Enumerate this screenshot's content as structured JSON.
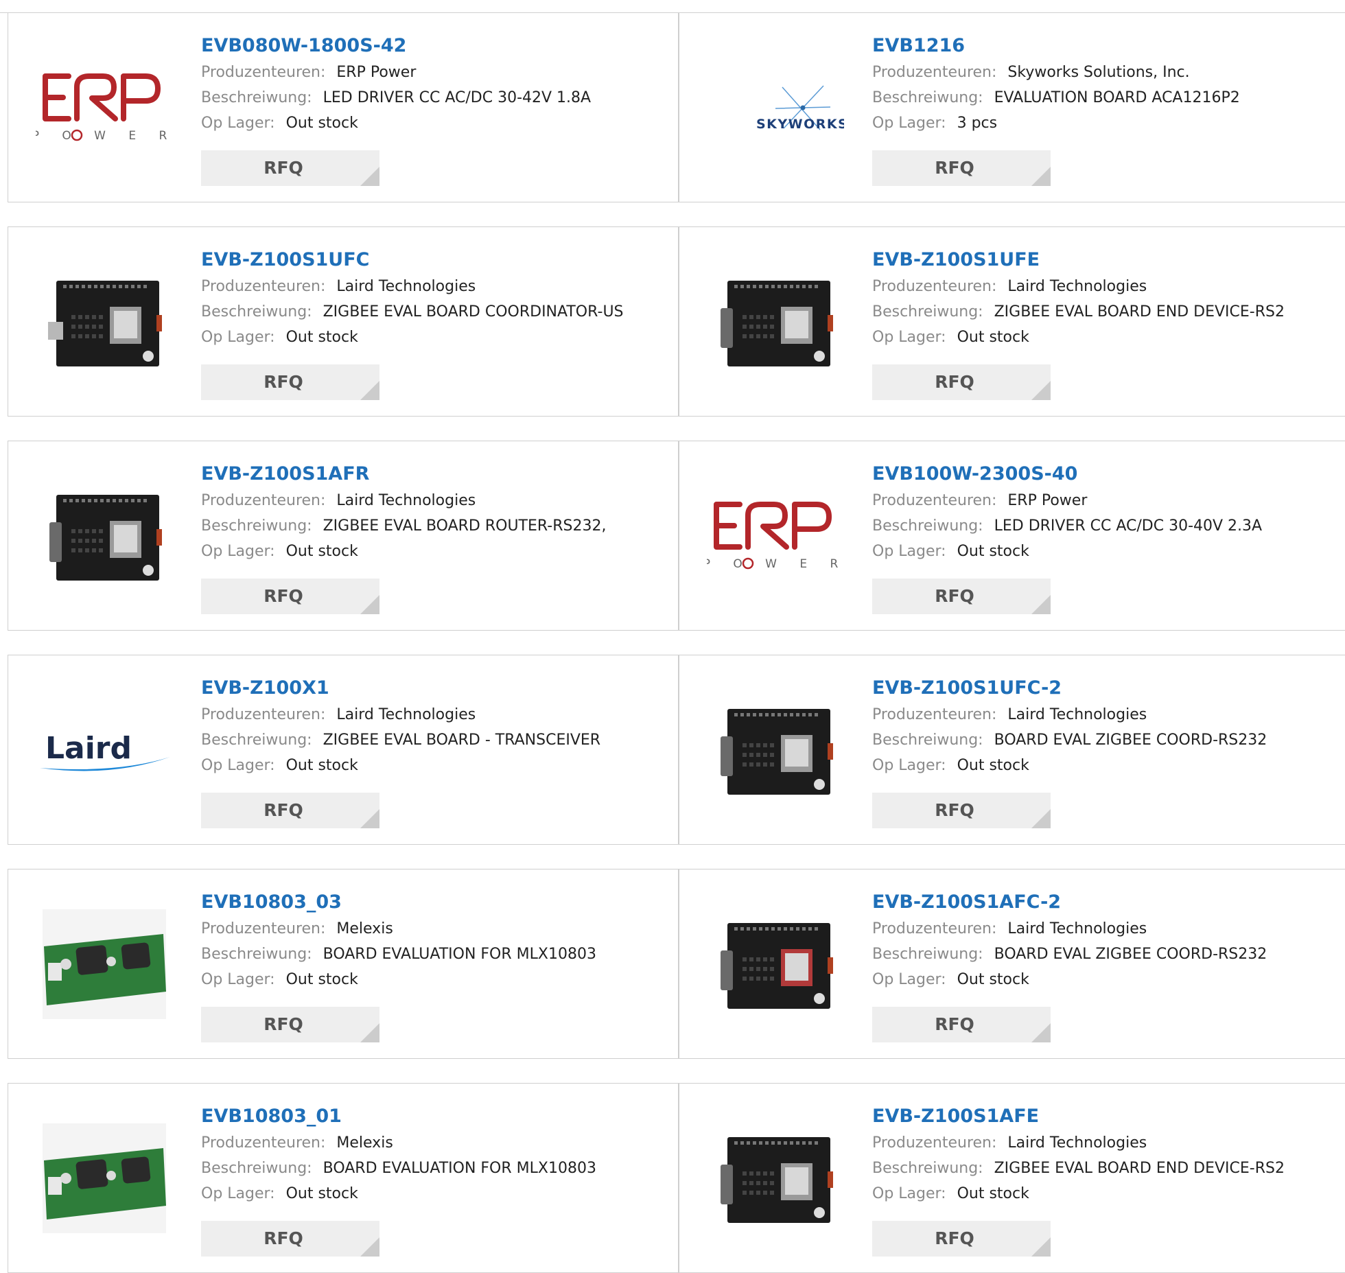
{
  "labels": {
    "manufacturer": "Produzenteuren:",
    "description": "Beschreiwung:",
    "stock": "Op Lager:",
    "rfq": "RFQ"
  },
  "colors": {
    "part_link": "#1f6fb8",
    "label": "#8a8a8a",
    "value": "#222222",
    "button_bg": "#eeeeee",
    "button_text": "#555555",
    "border": "#cfcfcf"
  },
  "products": [
    {
      "part": "EVB080W-1800S-42",
      "manufacturer": "ERP Power",
      "description": "LED DRIVER CC AC/DC 30-42V 1.8A",
      "stock": "Out stock",
      "image": "erp-power-logo"
    },
    {
      "part": "EVB1216",
      "manufacturer": "Skyworks Solutions, Inc.",
      "description": "EVALUATION BOARD ACA1216P2",
      "stock": "3 pcs",
      "image": "skyworks-logo"
    },
    {
      "part": "EVB-Z100S1UFC",
      "manufacturer": "Laird Technologies",
      "description": "ZIGBEE EVAL BOARD COORDINATOR-US",
      "stock": "Out stock",
      "image": "black-pcb-usb"
    },
    {
      "part": "EVB-Z100S1UFE",
      "manufacturer": "Laird Technologies",
      "description": "ZIGBEE EVAL BOARD END DEVICE-RS2",
      "stock": "Out stock",
      "image": "black-pcb-db9"
    },
    {
      "part": "EVB-Z100S1AFR",
      "manufacturer": "Laird Technologies",
      "description": "ZIGBEE EVAL BOARD ROUTER-RS232,",
      "stock": "Out stock",
      "image": "black-pcb-db9"
    },
    {
      "part": "EVB100W-2300S-40",
      "manufacturer": "ERP Power",
      "description": "LED DRIVER CC AC/DC 30-40V 2.3A",
      "stock": "Out stock",
      "image": "erp-power-logo"
    },
    {
      "part": "EVB-Z100X1",
      "manufacturer": "Laird Technologies",
      "description": "ZIGBEE EVAL BOARD - TRANSCEIVER",
      "stock": "Out stock",
      "image": "laird-logo"
    },
    {
      "part": "EVB-Z100S1UFC-2",
      "manufacturer": "Laird Technologies",
      "description": "BOARD EVAL ZIGBEE COORD-RS232",
      "stock": "Out stock",
      "image": "black-pcb-db9"
    },
    {
      "part": "EVB10803_03",
      "manufacturer": "Melexis",
      "description": "BOARD EVALUATION FOR MLX10803",
      "stock": "Out stock",
      "image": "green-pcb"
    },
    {
      "part": "EVB-Z100S1AFC-2",
      "manufacturer": "Laird Technologies",
      "description": "BOARD EVAL ZIGBEE COORD-RS232",
      "stock": "Out stock",
      "image": "black-pcb-db9-red"
    },
    {
      "part": "EVB10803_01",
      "manufacturer": "Melexis",
      "description": "BOARD EVALUATION FOR MLX10803",
      "stock": "Out stock",
      "image": "green-pcb"
    },
    {
      "part": "EVB-Z100S1AFE",
      "manufacturer": "Laird Technologies",
      "description": "ZIGBEE EVAL BOARD END DEVICE-RS2",
      "stock": "Out stock",
      "image": "black-pcb-db9"
    }
  ],
  "logos": {
    "skyworks": "SKYWORKS",
    "laird": "Laird",
    "erp_power": "P O W E R"
  }
}
